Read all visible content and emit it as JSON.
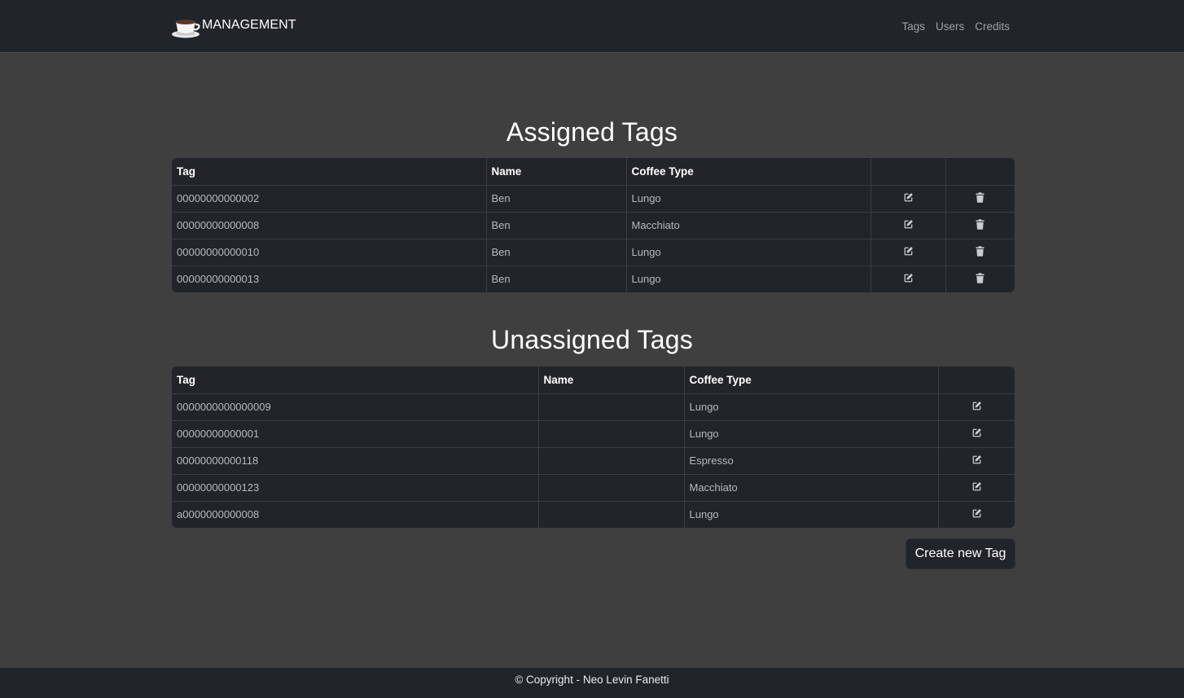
{
  "navbar": {
    "brand_icon": "coffee-cup-icon",
    "brand": "MANAGEMENT",
    "links": [
      "Tags",
      "Users",
      "Credits"
    ]
  },
  "assigned": {
    "title": "Assigned Tags",
    "columns": [
      "Tag",
      "Name",
      "Coffee Type",
      "",
      ""
    ],
    "rows": [
      {
        "tag": "00000000000002",
        "name": "Ben",
        "coffee": "Lungo"
      },
      {
        "tag": "00000000000008",
        "name": "Ben",
        "coffee": "Macchiato"
      },
      {
        "tag": "00000000000010",
        "name": "Ben",
        "coffee": "Lungo"
      },
      {
        "tag": "00000000000013",
        "name": "Ben",
        "coffee": "Lungo"
      }
    ],
    "row_icons": [
      "edit-icon",
      "trash-icon"
    ]
  },
  "unassigned": {
    "title": "Unassigned Tags",
    "columns": [
      "Tag",
      "Name",
      "Coffee Type",
      ""
    ],
    "rows": [
      {
        "tag": "0000000000000009",
        "name": "",
        "coffee": "Lungo"
      },
      {
        "tag": "00000000000001",
        "name": "",
        "coffee": "Lungo"
      },
      {
        "tag": "00000000000118",
        "name": "",
        "coffee": "Espresso"
      },
      {
        "tag": "00000000000123",
        "name": "",
        "coffee": "Macchiato"
      },
      {
        "tag": "a0000000000008",
        "name": "",
        "coffee": "Lungo"
      }
    ],
    "row_icons": [
      "edit-icon"
    ]
  },
  "create_button": "Create new Tag",
  "footer": "© Copyright - Neo Levin Fanetti",
  "colors": {
    "navbar_bg": "#212529",
    "page_bg": "#3f3f3f",
    "table_bg": "#212529",
    "icon": "#c9cdd1"
  }
}
